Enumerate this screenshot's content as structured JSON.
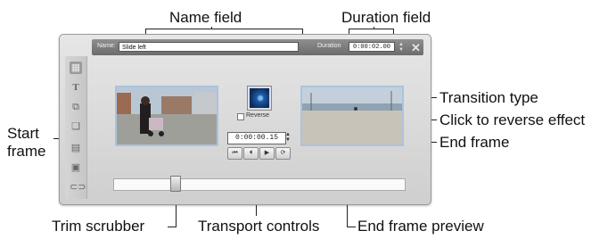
{
  "callouts": {
    "name_field": "Name field",
    "duration_field": "Duration field",
    "start_frame": "Start frame",
    "transition_type": "Transition type",
    "click_to_reverse": "Click to reverse effect",
    "end_frame": "End frame",
    "trim_scrubber": "Trim scrubber",
    "transport_controls": "Transport controls",
    "end_frame_preview": "End frame preview"
  },
  "window": {
    "name_label": "Name:",
    "name_value": "Slide left",
    "duration_label": "Duration",
    "duration_value": "0:00:02.00",
    "close_icon": "close-icon"
  },
  "tools": [
    "transition-icon",
    "text-icon",
    "copy-icon",
    "properties-icon",
    "layers-icon",
    "settings-icon",
    "link-icon"
  ],
  "reverse_label": "Reverse",
  "timecode": "0:00:00.15",
  "transport": {
    "go_start": "⏮",
    "step_back": "⏴",
    "play": "▶",
    "loop": "⟳"
  },
  "colors": {
    "frame_border": "#a9c4df",
    "titlebar": "#7a7a7a",
    "transition_icon": "#1d5da8"
  },
  "scrubber_position": 0.22
}
